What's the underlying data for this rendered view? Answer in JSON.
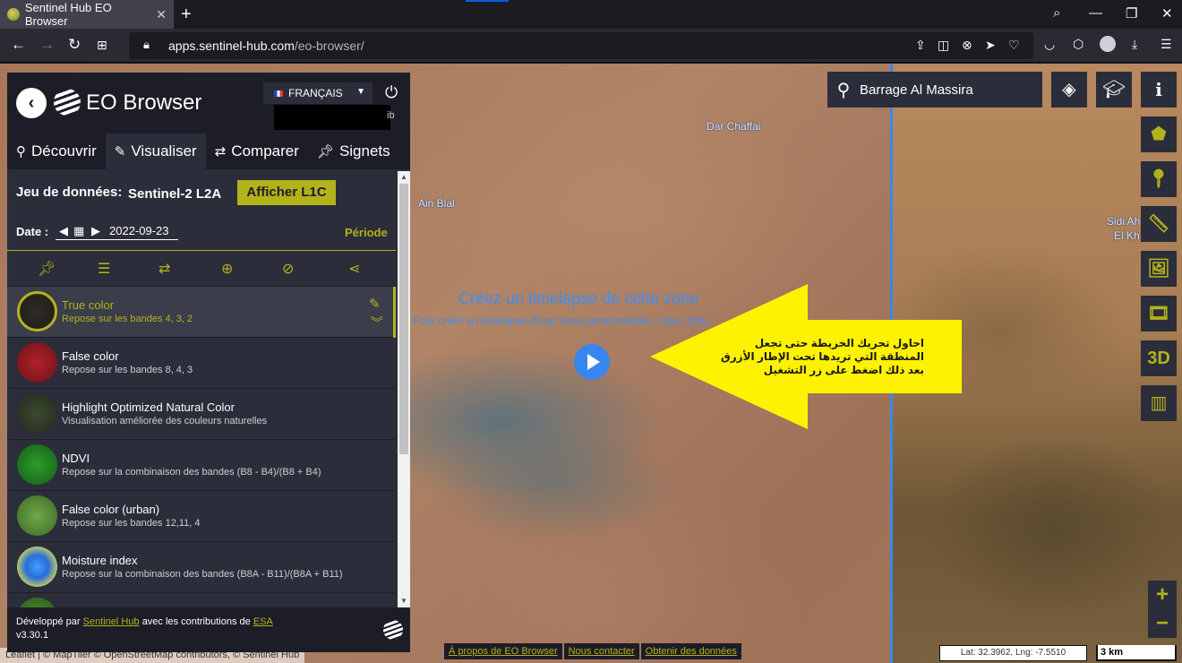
{
  "browser": {
    "tab_title": "Sentinel Hub EO Browser",
    "url_host": "apps.sentinel-hub.com",
    "url_path": "/eo-browser/"
  },
  "panel": {
    "brand": "EO Browser",
    "language": "FRANÇAIS",
    "user_suffix": "ib",
    "tabs": [
      {
        "label": "Découvrir",
        "icon": "search-icon"
      },
      {
        "label": "Visualiser",
        "icon": "paintbrush-icon"
      },
      {
        "label": "Comparer",
        "icon": "swap-icon"
      },
      {
        "label": "Signets",
        "icon": "pin-icon"
      }
    ],
    "dataset_label": "Jeu de données:",
    "dataset_value": "Sentinel-2 L2A",
    "l1c_button": "Afficher L1C",
    "date_label": "Date :",
    "date_value": "2022-09-23",
    "period_link": "Période",
    "layers": [
      {
        "name": "True color",
        "desc": "Repose sur les bandes 4, 3, 2"
      },
      {
        "name": "False color",
        "desc": "Repose sur les bandes 8, 4, 3"
      },
      {
        "name": "Highlight Optimized Natural Color",
        "desc": "Visualisation améliorée des couleurs naturelles"
      },
      {
        "name": "NDVI",
        "desc": "Repose sur la combinaison des bandes (B8 - B4)/(B8 + B4)"
      },
      {
        "name": "False color (urban)",
        "desc": "Repose sur les bandes 12,11, 4"
      },
      {
        "name": "Moisture index",
        "desc": "Repose sur la combinaison des bandes (B8A - B11)/(B8A + B11)"
      }
    ],
    "footer": {
      "developed_by": "Développé par",
      "sentinel_hub": "Sentinel Hub",
      "with_contrib": "avec les contributions de",
      "esa": "ESA",
      "version": "v3.30.1"
    }
  },
  "map": {
    "search_value": "Barrage Al Massira",
    "labels": {
      "dar_chaffai": "Dar Chaffai",
      "ain_blal": "Ain Blal",
      "sidi_ah": "Sidi Ah",
      "el_kh": "El Kh"
    },
    "timelapse_title": "Créez un timelapse de cette zone",
    "timelapse_sub": "Pour créer un timelapse d'une zone personnalisée, créez d'ab",
    "annotation_line1": "احاول تحريك الخريطة حتى تجعل",
    "annotation_line2": "المنطقة التي تريدها تحت الإطار الأزرق",
    "annotation_line3": "بعد ذلك اضغط على زر التشغيل",
    "tool_3d": "3D",
    "zoom_in": "+",
    "zoom_out": "−",
    "attribution": "Leaflet | © MapTiler © OpenStreetMap contributors, © Sentinel Hub",
    "links": [
      "À propos de EO Browser",
      "Nous contacter",
      "Obtenir des données"
    ],
    "coords": "Lat: 32.3962, Lng: -7.5510",
    "scale": "3 km"
  },
  "colors": {
    "accent": "#b3b21b",
    "panel_bg": "#2b2d3a",
    "panel_dark": "#1c1d26",
    "timelapse_blue": "#3a86f0",
    "annotation_yellow": "#fff200"
  }
}
